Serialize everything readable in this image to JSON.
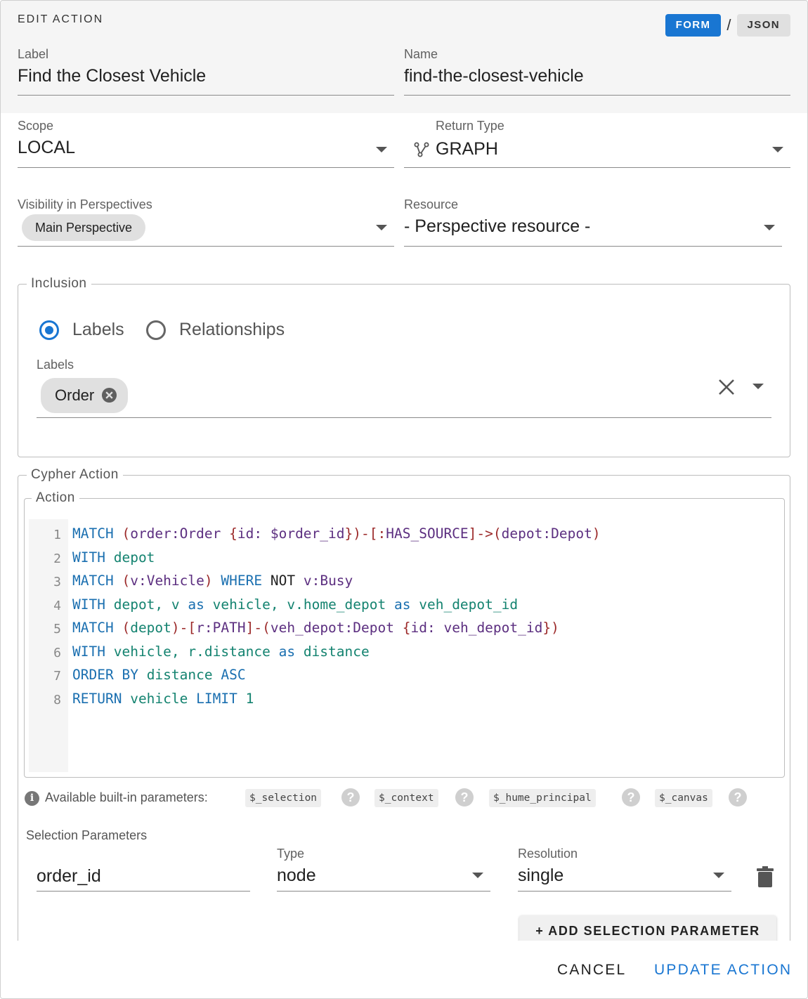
{
  "dialog": {
    "title": "EDIT ACTION",
    "mode_form": "FORM",
    "mode_separator": "/",
    "mode_json": "JSON"
  },
  "label_field": {
    "label": "Label",
    "value": "Find the Closest Vehicle"
  },
  "name_field": {
    "label": "Name",
    "value": "find-the-closest-vehicle"
  },
  "scope_field": {
    "label": "Scope",
    "value": "LOCAL"
  },
  "return_type_field": {
    "label": "Return Type",
    "value": "GRAPH",
    "icon": "graph-icon"
  },
  "visibility_field": {
    "label": "Visibility in Perspectives",
    "chip": "Main Perspective"
  },
  "resource_field": {
    "label": "Resource",
    "value": "- Perspective resource -"
  },
  "inclusion": {
    "legend": "Inclusion",
    "radio_labels": "Labels",
    "radio_relationships": "Relationships",
    "selected": "Labels",
    "labels_field_label": "Labels",
    "chips": [
      "Order"
    ]
  },
  "cypher": {
    "legend": "Cypher Action",
    "action_legend": "Action",
    "line_numbers": [
      "1",
      "2",
      "3",
      "4",
      "5",
      "6",
      "7",
      "8"
    ],
    "lines": [
      "MATCH (order:Order {id: $order_id})-[:HAS_SOURCE]->(depot:Depot)",
      "WITH depot",
      "MATCH (v:Vehicle) WHERE NOT v:Busy",
      "WITH depot, v as vehicle, v.home_depot as veh_depot_id",
      "MATCH (depot)-[r:PATH]-(veh_depot:Depot {id: veh_depot_id})",
      "WITH vehicle, r.distance as distance",
      "ORDER BY distance ASC",
      "RETURN vehicle LIMIT 1"
    ]
  },
  "builtins": {
    "label": "Available built-in parameters:",
    "params": [
      "$_selection",
      "$_context",
      "$_hume_principal",
      "$_canvas"
    ],
    "help_glyph": "?",
    "info_glyph": "i"
  },
  "selection_params": {
    "title": "Selection Parameters",
    "param_name": "order_id",
    "type_label": "Type",
    "type_value": "node",
    "resolution_label": "Resolution",
    "resolution_value": "single",
    "add_button": "+ ADD SELECTION PARAMETER"
  },
  "footer": {
    "cancel": "CANCEL",
    "update": "UPDATE ACTION"
  },
  "colors": {
    "accent": "#1976d2",
    "keyword": "#1a6fb0",
    "variable": "#5c2f80",
    "identifier": "#148370",
    "punct": "#9c2a2a"
  }
}
